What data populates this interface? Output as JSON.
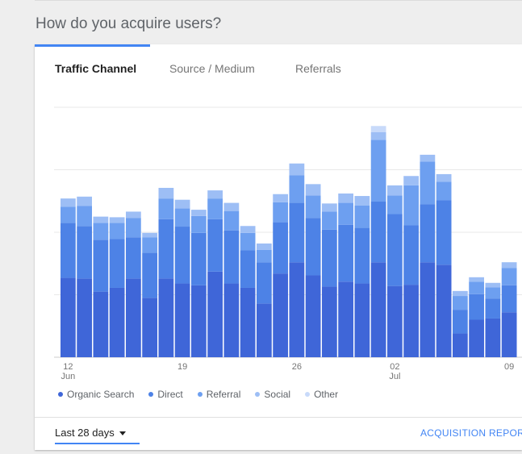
{
  "section_title": "How do you acquire users?",
  "tabs": [
    {
      "label": "Traffic Channel",
      "active": true
    },
    {
      "label": "Source / Medium",
      "active": false
    },
    {
      "label": "Referrals",
      "active": false
    }
  ],
  "colors": {
    "accent": "#4285f4",
    "organic_search": "#3f66d8",
    "direct": "#4d82e6",
    "referral": "#6d9ff0",
    "social": "#9dbef5",
    "other": "#c8dafa"
  },
  "chart_data": {
    "type": "bar",
    "stacked": true,
    "grid": true,
    "y_axis_labels_visible": false,
    "legend_position": "bottom-left",
    "x_tick_labels": [
      {
        "label": "12",
        "sublabel": "Jun",
        "index": 0
      },
      {
        "label": "19",
        "sublabel": "",
        "index": 7
      },
      {
        "label": "26",
        "sublabel": "",
        "index": 14
      },
      {
        "label": "02",
        "sublabel": "Jul",
        "index": 20
      },
      {
        "label": "09",
        "sublabel": "",
        "index": 27
      }
    ],
    "categories": [
      "Jun 12",
      "Jun 13",
      "Jun 14",
      "Jun 15",
      "Jun 16",
      "Jun 17",
      "Jun 18",
      "Jun 19",
      "Jun 20",
      "Jun 21",
      "Jun 22",
      "Jun 23",
      "Jun 24",
      "Jun 25",
      "Jun 26",
      "Jun 27",
      "Jun 28",
      "Jun 29",
      "Jun 30",
      "Jul 1",
      "Jul 2",
      "Jul 3",
      "Jul 4",
      "Jul 5",
      "Jul 6",
      "Jul 7",
      "Jul 8",
      "Jul 9"
    ],
    "ylim": [
      0,
      4
    ],
    "series": [
      {
        "name": "Organic Search",
        "values": [
          1.27,
          1.26,
          1.05,
          1.11,
          1.26,
          0.95,
          1.26,
          1.18,
          1.15,
          1.37,
          1.18,
          1.11,
          0.86,
          1.34,
          1.52,
          1.31,
          1.13,
          1.21,
          1.18,
          1.52,
          1.14,
          1.16,
          1.52,
          1.48,
          0.38,
          0.6,
          0.62,
          0.72
        ]
      },
      {
        "name": "Direct",
        "values": [
          0.88,
          0.84,
          0.83,
          0.78,
          0.66,
          0.72,
          0.95,
          0.91,
          0.84,
          0.84,
          0.85,
          0.6,
          0.66,
          0.82,
          0.95,
          0.92,
          0.91,
          0.91,
          0.89,
          0.97,
          1.15,
          0.95,
          0.93,
          1.03,
          0.38,
          0.41,
          0.32,
          0.43
        ]
      },
      {
        "name": "Referral",
        "values": [
          0.26,
          0.32,
          0.27,
          0.26,
          0.31,
          0.25,
          0.33,
          0.29,
          0.27,
          0.33,
          0.31,
          0.28,
          0.2,
          0.32,
          0.44,
          0.36,
          0.29,
          0.35,
          0.36,
          0.99,
          0.3,
          0.64,
          0.68,
          0.3,
          0.22,
          0.2,
          0.18,
          0.28
        ]
      },
      {
        "name": "Social",
        "values": [
          0.13,
          0.15,
          0.1,
          0.09,
          0.1,
          0.07,
          0.17,
          0.14,
          0.1,
          0.13,
          0.13,
          0.11,
          0.1,
          0.13,
          0.19,
          0.18,
          0.13,
          0.15,
          0.15,
          0.12,
          0.16,
          0.15,
          0.11,
          0.12,
          0.08,
          0.07,
          0.07,
          0.09
        ]
      },
      {
        "name": "Other",
        "values": [
          0,
          0,
          0,
          0,
          0,
          0,
          0,
          0,
          0,
          0,
          0,
          0,
          0,
          0,
          0,
          0,
          0,
          0,
          0,
          0.1,
          0,
          0,
          0,
          0,
          0,
          0,
          0,
          0
        ]
      }
    ]
  },
  "footer": {
    "date_range": "Last 28 days",
    "report_link": "ACQUISITION REPORT"
  }
}
